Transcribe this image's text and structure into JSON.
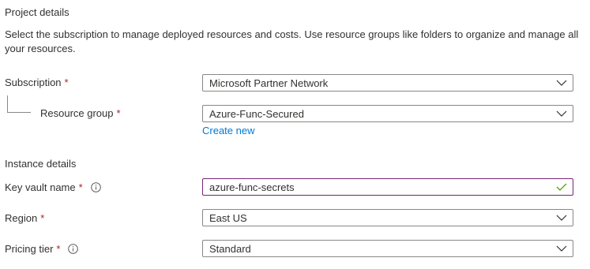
{
  "project": {
    "title": "Project details",
    "description": "Select the subscription to manage deployed resources and costs. Use resource groups like folders to organize and manage all your resources."
  },
  "subscription": {
    "label": "Subscription",
    "required_mark": "*",
    "value": "Microsoft Partner Network"
  },
  "resource_group": {
    "label": "Resource group",
    "required_mark": "*",
    "value": "Azure-Func-Secured",
    "create_new_link": "Create new"
  },
  "instance": {
    "title": "Instance details"
  },
  "key_vault_name": {
    "label": "Key vault name",
    "required_mark": "*",
    "value": "azure-func-secrets",
    "info_icon": "info-icon",
    "status_icon": "checkmark-icon"
  },
  "region": {
    "label": "Region",
    "required_mark": "*",
    "value": "East US"
  },
  "pricing_tier": {
    "label": "Pricing tier",
    "required_mark": "*",
    "value": "Standard",
    "info_icon": "info-icon"
  },
  "colors": {
    "required": "#a4262c",
    "link": "#0078d4",
    "valid_check": "#57a300",
    "focused_border": "#742774",
    "border": "#8a8886"
  }
}
